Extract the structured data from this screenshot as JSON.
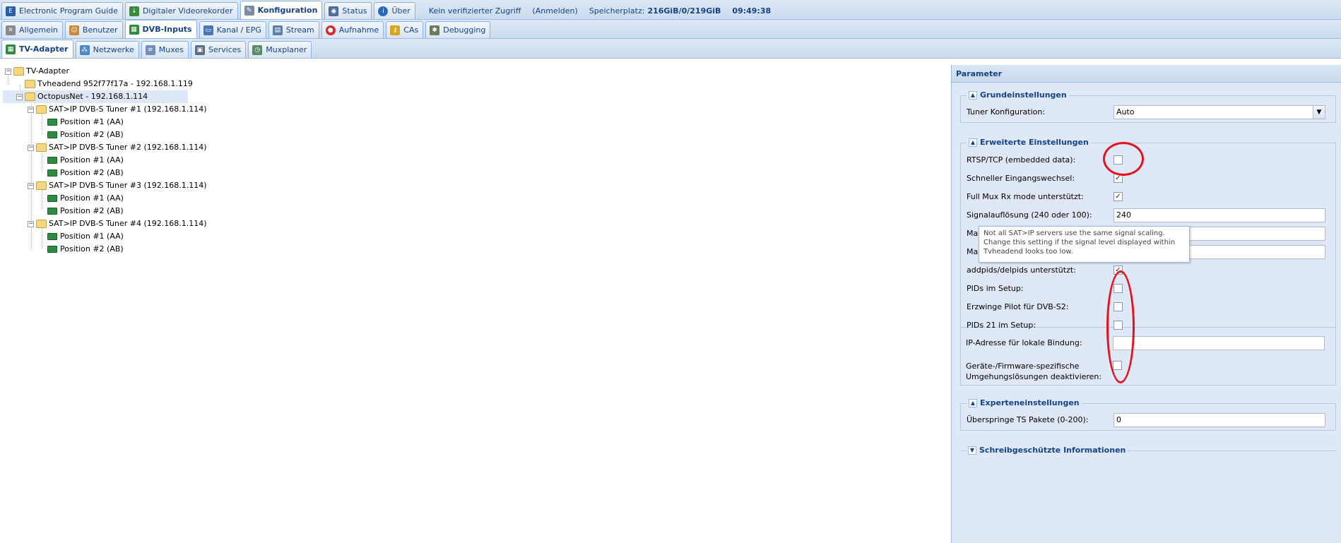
{
  "header": {
    "tabs": [
      {
        "label": "Electronic Program Guide",
        "icon": "epg-icon"
      },
      {
        "label": "Digitaler Videorekorder",
        "icon": "download-icon"
      },
      {
        "label": "Konfiguration",
        "icon": "wrench-icon",
        "active": true
      },
      {
        "label": "Status",
        "icon": "eye-icon"
      },
      {
        "label": "Über",
        "icon": "info-icon"
      }
    ],
    "access_text": "Kein verifizierter Zugriff",
    "login_link": "(Anmelden)",
    "storage_label": "Speicherplatz:",
    "storage_value": "216GiB/0/219GiB",
    "clock": "09:49:38"
  },
  "config_tabs": [
    {
      "label": "Allgemein",
      "icon": "tools-icon"
    },
    {
      "label": "Benutzer",
      "icon": "users-icon"
    },
    {
      "label": "DVB-Inputs",
      "icon": "dvb-card-icon",
      "active": true
    },
    {
      "label": "Kanal / EPG",
      "icon": "tv-icon"
    },
    {
      "label": "Stream",
      "icon": "film-icon"
    },
    {
      "label": "Aufnahme",
      "icon": "record-icon"
    },
    {
      "label": "CAs",
      "icon": "key-icon"
    },
    {
      "label": "Debugging",
      "icon": "bug-icon"
    }
  ],
  "dvb_tabs": [
    {
      "label": "TV-Adapter",
      "icon": "tv-adapter-icon",
      "active": true
    },
    {
      "label": "Netzwerke",
      "icon": "network-icon"
    },
    {
      "label": "Muxes",
      "icon": "mux-icon"
    },
    {
      "label": "Services",
      "icon": "services-icon"
    },
    {
      "label": "Muxplaner",
      "icon": "muxplaner-icon"
    }
  ],
  "tree": {
    "root": "TV-Adapter",
    "server1": "Tvheadend 952f77f17a - 192.168.1.119",
    "server2": "OctopusNet - 192.168.1.114",
    "tuner1": "SAT>IP DVB-S Tuner #1 (192.168.1.114)",
    "tuner2": "SAT>IP DVB-S Tuner #2 (192.168.1.114)",
    "tuner3": "SAT>IP DVB-S Tuner #3 (192.168.1.114)",
    "tuner4": "SAT>IP DVB-S Tuner #4 (192.168.1.114)",
    "pos1": "Position #1 (AA)",
    "pos2": "Position #2 (AB)"
  },
  "panel": {
    "title": "Parameter",
    "basic": {
      "title": "Grundeinstellungen",
      "tuner_config_label": "Tuner Konfiguration:",
      "tuner_config_value": "Auto"
    },
    "advanced": {
      "title": "Erweiterte Einstellungen",
      "rtsp_label": "RTSP/TCP (embedded data):",
      "rtsp_checked": false,
      "fast_switch_label": "Schneller Eingangswechsel:",
      "fast_switch_checked": true,
      "full_mux_label": "Full Mux Rx mode unterstützt:",
      "full_mux_checked": true,
      "signal_label": "Signalauflösung (240 oder 100):",
      "signal_value": "240",
      "ma1_label": "Ma",
      "ma2_label": "Ma",
      "addpids_label": "addpids/delpids unterstützt:",
      "addpids_checked": true,
      "pids_setup_label": "PIDs im Setup:",
      "pids_setup_checked": false,
      "pilot_label": "Erzwinge Pilot für DVB-S2:",
      "pilot_checked": false,
      "pids21_label": "PIDs 21 im Setup:",
      "pids21_checked": false,
      "ip_label": "IP-Adresse für lokale Bindung:",
      "ip_value": "",
      "workaround_label_1": "Geräte-/Firmware-spezifische",
      "workaround_label_2": "Umgehungslösungen deaktivieren:",
      "workaround_checked": false
    },
    "expert": {
      "title": "Experteneinstellungen",
      "skip_ts_label": "Überspringe TS Pakete (0-200):",
      "skip_ts_value": "0"
    },
    "readonly": {
      "title": "Schreibgeschützte Informationen"
    }
  },
  "tooltip": "Not all SAT>IP servers use the same signal scaling. Change this setting if the signal level displayed within Tvheadend looks too low.",
  "annotation_color": "#e8101d"
}
